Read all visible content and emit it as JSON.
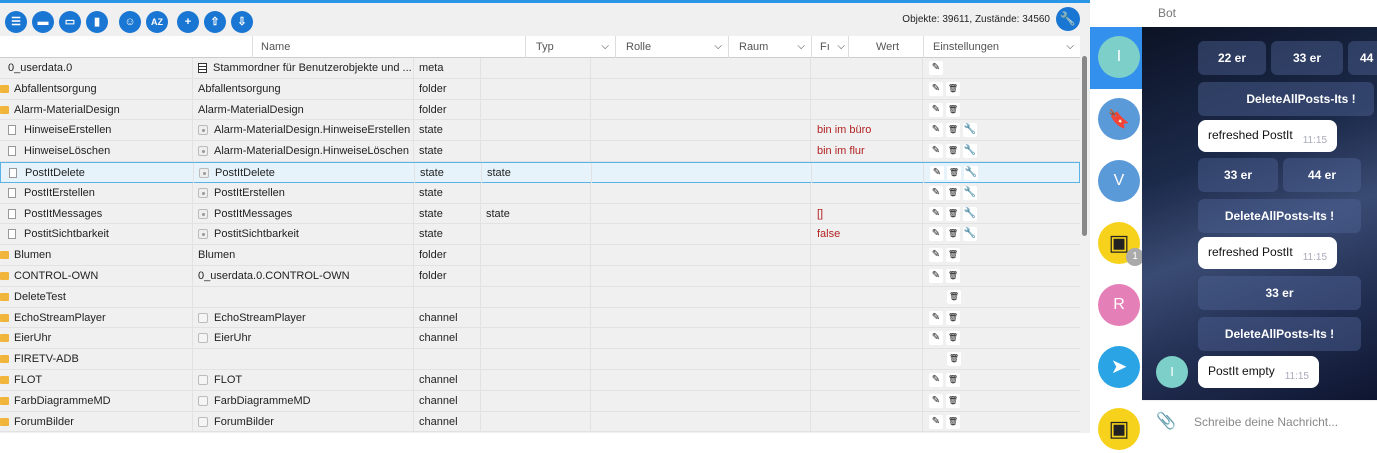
{
  "toolbar": {
    "buttons": [
      {
        "icon": "list-icon",
        "glyph": "☰"
      },
      {
        "icon": "folder-icon",
        "glyph": "▬"
      },
      {
        "icon": "folder-open-icon",
        "glyph": "▭"
      },
      {
        "icon": "save-icon",
        "glyph": "▮"
      },
      {
        "icon": "user-icon",
        "glyph": "☺"
      },
      {
        "icon": "sort-az-icon",
        "glyph": "AZ"
      },
      {
        "icon": "add-icon",
        "glyph": "+"
      },
      {
        "icon": "upload-icon",
        "glyph": "⇧"
      },
      {
        "icon": "download-icon",
        "glyph": "⇩"
      }
    ],
    "stats": "Objekte: 39611, Zustände: 34560"
  },
  "columns": {
    "name": "Name",
    "type": "Typ",
    "role": "Rolle",
    "room": "Raum",
    "func": "Fı",
    "value": "Wert",
    "settings": "Einstellungen"
  },
  "rows": [
    {
      "id": "0_userdata.0",
      "icon": "none",
      "indent": 0,
      "name": "Stammordner für Benutzerobjekte und ...",
      "nicon": "meta",
      "type": "meta",
      "role": "",
      "value": "",
      "actions": [
        "edit"
      ]
    },
    {
      "id": "Abfallentsorgung",
      "icon": "folder",
      "indent": 0,
      "name": "Abfallentsorgung",
      "nicon": "none",
      "type": "folder",
      "role": "",
      "value": "",
      "actions": [
        "edit",
        "delete"
      ]
    },
    {
      "id": "Alarm-MaterialDesign",
      "icon": "folder",
      "indent": 0,
      "name": "Alarm-MaterialDesign",
      "nicon": "none",
      "type": "folder",
      "role": "",
      "value": "",
      "actions": [
        "edit",
        "delete"
      ]
    },
    {
      "id": "HinweiseErstellen",
      "icon": "file",
      "indent": 1,
      "name": "Alarm-MaterialDesign.HinweiseErstellen",
      "nicon": "state",
      "type": "state",
      "role": "",
      "value": "bin im büro",
      "actions": [
        "edit",
        "delete",
        "wrench"
      ]
    },
    {
      "id": "HinweiseLöschen",
      "icon": "file",
      "indent": 1,
      "name": "Alarm-MaterialDesign.HinweiseLöschen",
      "nicon": "state",
      "type": "state",
      "role": "",
      "value": "bin im flur",
      "actions": [
        "edit",
        "delete",
        "wrench"
      ]
    },
    {
      "id": "PostItDelete",
      "icon": "file",
      "indent": 1,
      "name": "PostItDelete",
      "nicon": "state",
      "type": "state",
      "role": "state",
      "value": "",
      "actions": [
        "edit",
        "delete",
        "wrench"
      ],
      "selected": true
    },
    {
      "id": "PostItErstellen",
      "icon": "file",
      "indent": 1,
      "name": "PostItErstellen",
      "nicon": "state",
      "type": "state",
      "role": "",
      "value": "",
      "actions": [
        "edit",
        "delete",
        "wrench"
      ]
    },
    {
      "id": "PostItMessages",
      "icon": "file",
      "indent": 1,
      "name": "PostItMessages",
      "nicon": "state",
      "type": "state",
      "role": "state",
      "value": "[]",
      "actions": [
        "edit",
        "delete",
        "wrench"
      ]
    },
    {
      "id": "PostitSichtbarkeit",
      "icon": "file",
      "indent": 1,
      "name": "PostitSichtbarkeit",
      "nicon": "state",
      "type": "state",
      "role": "",
      "value": "false",
      "actions": [
        "edit",
        "delete",
        "wrench"
      ]
    },
    {
      "id": "Blumen",
      "icon": "folder",
      "indent": 0,
      "name": "Blumen",
      "nicon": "none",
      "type": "folder",
      "role": "",
      "value": "",
      "actions": [
        "edit",
        "delete"
      ]
    },
    {
      "id": "CONTROL-OWN",
      "icon": "folder",
      "indent": 0,
      "name": "0_userdata.0.CONTROL-OWN",
      "nicon": "none",
      "type": "folder",
      "role": "",
      "value": "",
      "actions": [
        "edit",
        "delete"
      ]
    },
    {
      "id": "DeleteTest",
      "icon": "folder",
      "indent": 0,
      "name": "",
      "nicon": "none",
      "type": "",
      "role": "",
      "value": "",
      "actions": [
        "delete"
      ]
    },
    {
      "id": "EchoStreamPlayer",
      "icon": "folder",
      "indent": 0,
      "name": "EchoStreamPlayer",
      "nicon": "channel",
      "type": "channel",
      "role": "",
      "value": "",
      "actions": [
        "edit",
        "delete"
      ]
    },
    {
      "id": "EierUhr",
      "icon": "folder",
      "indent": 0,
      "name": "EierUhr",
      "nicon": "channel",
      "type": "channel",
      "role": "",
      "value": "",
      "actions": [
        "edit",
        "delete"
      ]
    },
    {
      "id": "FIRETV-ADB",
      "icon": "folder",
      "indent": 0,
      "name": "",
      "nicon": "none",
      "type": "",
      "role": "",
      "value": "",
      "actions": [
        "delete"
      ]
    },
    {
      "id": "FLOT",
      "icon": "folder",
      "indent": 0,
      "name": "FLOT",
      "nicon": "channel",
      "type": "channel",
      "role": "",
      "value": "",
      "actions": [
        "edit",
        "delete"
      ]
    },
    {
      "id": "FarbDiagrammeMD",
      "icon": "folder",
      "indent": 0,
      "name": "FarbDiagrammeMD",
      "nicon": "channel",
      "type": "channel",
      "role": "",
      "value": "",
      "actions": [
        "edit",
        "delete"
      ]
    },
    {
      "id": "ForumBilder",
      "icon": "folder",
      "indent": 0,
      "name": "ForumBilder",
      "nicon": "channel",
      "type": "channel",
      "role": "",
      "value": "",
      "actions": [
        "edit",
        "delete"
      ]
    }
  ],
  "chat": {
    "header": "Bot",
    "avatars": [
      {
        "letter": "I",
        "color": "#7dcfc9"
      },
      {
        "letter": "",
        "color": "#5b9ad8",
        "icon": "bookmark-icon"
      },
      {
        "letter": "V",
        "color": "#5b9ad8"
      },
      {
        "letter": "",
        "color": "#f7d21c",
        "icon": "bot-face-icon",
        "badge": "1"
      },
      {
        "letter": "R",
        "color": "#e57fb8"
      },
      {
        "letter": "",
        "color": "#2aa4e4",
        "icon": "telegram-icon"
      },
      {
        "letter": "",
        "color": "#f7d21c",
        "icon": "bot-face-icon"
      }
    ],
    "keyboard1": [
      "22 er",
      "33 er",
      "44"
    ],
    "btn_delete1": "DeleteAllPosts-Its !",
    "msg1": {
      "text": "refreshed PostIt",
      "time": "11:15"
    },
    "keyboard2": [
      "33 er",
      "44 er"
    ],
    "btn_delete2": "DeleteAllPosts-Its !",
    "msg2": {
      "text": "refreshed PostIt",
      "time": "11:15"
    },
    "keyboard3": "33 er",
    "btn_delete3": "DeleteAllPosts-Its !",
    "msg3": {
      "text": "PostIt empty",
      "time": "11:15"
    },
    "sender_avatar": "I",
    "input_placeholder": "Schreibe deine Nachricht..."
  }
}
